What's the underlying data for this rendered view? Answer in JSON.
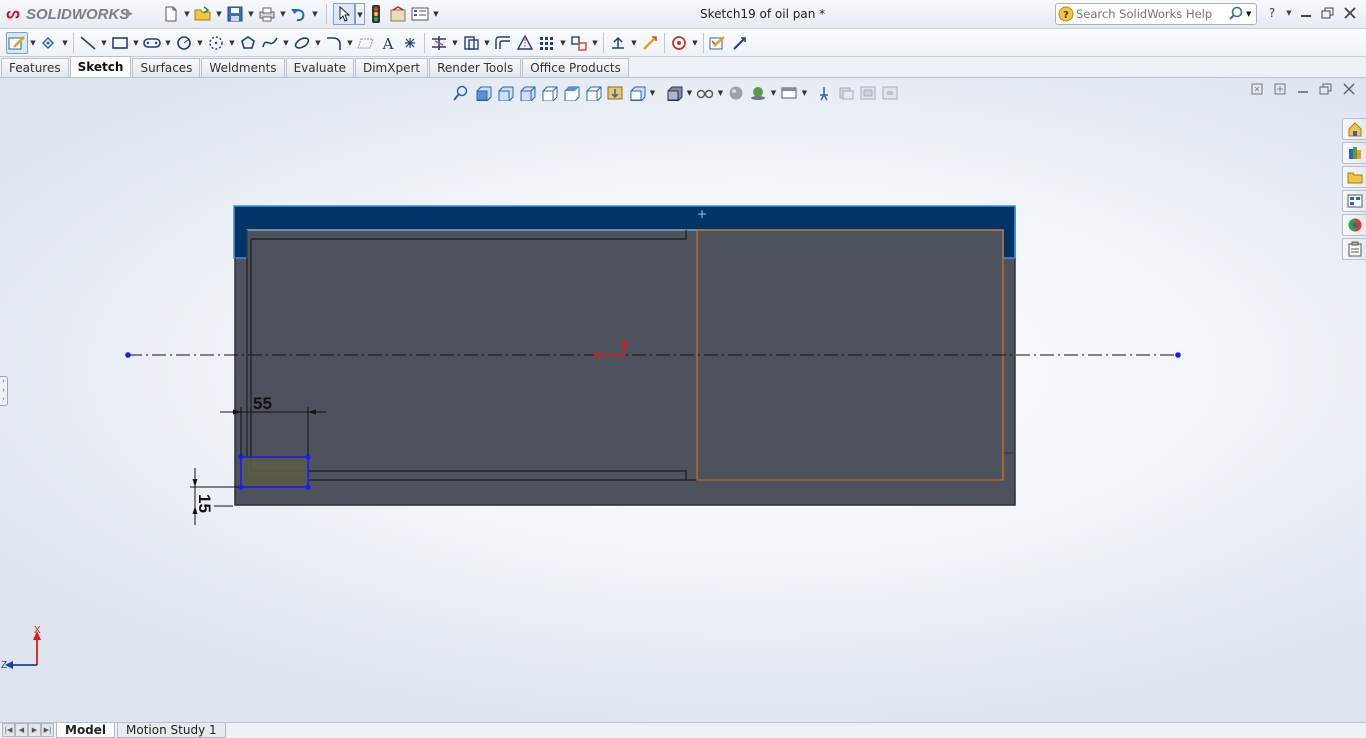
{
  "app": {
    "logo_text": "SOLIDWORKS",
    "document_title": "Sketch19 of oil pan *"
  },
  "search": {
    "placeholder": "Search SolidWorks Help"
  },
  "command_tabs": [
    {
      "label": "Features"
    },
    {
      "label": "Sketch"
    },
    {
      "label": "Surfaces"
    },
    {
      "label": "Weldments"
    },
    {
      "label": "Evaluate"
    },
    {
      "label": "DimXpert"
    },
    {
      "label": "Render Tools"
    },
    {
      "label": "Office Products"
    }
  ],
  "active_tab": "Sketch",
  "sketch": {
    "dimension_width": "55",
    "dimension_height": "15",
    "part_color": "#4e525c",
    "highlight_color": "#003366",
    "sketch_line_color": "#1a1aff",
    "construction_color": "#d06a1a"
  },
  "triad": {
    "x_label": "X",
    "z_label": "Z"
  },
  "bottom_tabs": [
    {
      "label": "Model"
    },
    {
      "label": "Motion Study 1"
    }
  ]
}
